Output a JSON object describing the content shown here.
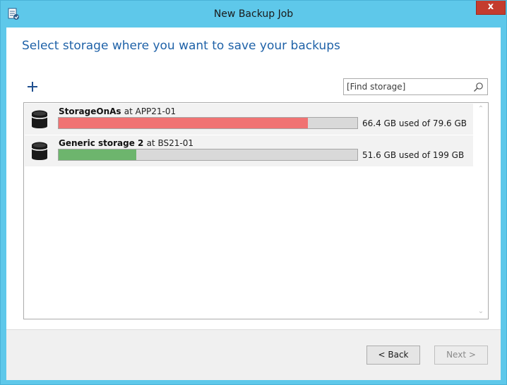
{
  "window": {
    "title": "New Backup Job",
    "close_label": "x",
    "app_icon": "backup-job-icon"
  },
  "heading": "Select storage where you want to save your backups",
  "toolbar": {
    "add_icon": "plus-icon",
    "search_placeholder": "[Find storage]",
    "search_icon": "magnifier-icon"
  },
  "storages": [
    {
      "name": "StorageOnAs",
      "at_text": "at APP21-01",
      "usage_text": "66.4 GB used of 79.6 GB",
      "used_gb": 66.4,
      "total_gb": 79.6,
      "fill_color": "#f07373",
      "icon": "database-icon"
    },
    {
      "name": "Generic storage 2",
      "at_text": "at BS21-01",
      "usage_text": "51.6 GB used of 199 GB",
      "used_gb": 51.6,
      "total_gb": 199,
      "fill_color": "#6db56d",
      "icon": "database-icon"
    }
  ],
  "footer": {
    "back_label": "< Back",
    "next_label": "Next >"
  },
  "colors": {
    "titlebar": "#5ec8ea",
    "heading": "#1f62a8",
    "close": "#c43c2e"
  }
}
